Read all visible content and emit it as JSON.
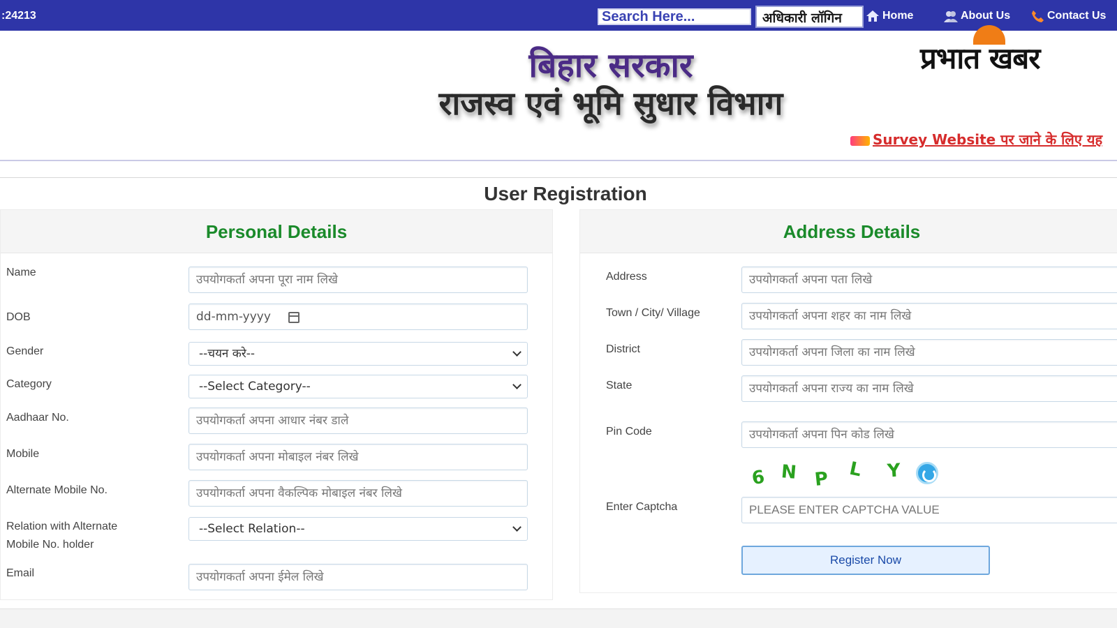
{
  "topbar": {
    "counter": ":24213",
    "search_placeholder": "Search Here...",
    "login_label": "अधिकारी लॉगिन",
    "nav": [
      {
        "label": "Home",
        "icon": "home-icon"
      },
      {
        "label": "About Us",
        "icon": "users-icon"
      },
      {
        "label": "Contact Us",
        "icon": "phone-icon"
      }
    ],
    "bg_color": "#2e35a8"
  },
  "header": {
    "line1": "बिहार सरकार",
    "line2": "राजस्व एवं भूमि सुधार विभाग",
    "logo_text": "प्रभात खबर",
    "survey_link": "Survey Website पर जाने के लिए यह"
  },
  "form": {
    "title": "User Registration",
    "personal": {
      "heading": "Personal Details",
      "name_label": "Name",
      "name_placeholder": "उपयोगकर्ता अपना पूरा नाम लिखे",
      "dob_label": "DOB",
      "dob_placeholder": "dd-mm-yyyy",
      "gender_label": "Gender",
      "gender_value": "--चयन करे--",
      "category_label": "Category",
      "category_value": "--Select Category--",
      "aadhaar_label": "Aadhaar No.",
      "aadhaar_placeholder": "उपयोगकर्ता अपना आधार नंबर डाले",
      "mobile_label": "Mobile",
      "mobile_placeholder": "उपयोगकर्ता अपना मोबाइल नंबर लिखे",
      "alt_mobile_label": "Alternate Mobile No.",
      "alt_mobile_placeholder": "उपयोगकर्ता अपना वैकल्पिक मोबाइल नंबर लिखे",
      "relation_label_1": "Relation with Alternate",
      "relation_label_2": "Mobile No. holder",
      "relation_value": "--Select Relation--",
      "email_label": "Email",
      "email_placeholder": "उपयोगकर्ता अपना ईमेल लिखे"
    },
    "address": {
      "heading": "Address Details",
      "address_label": "Address",
      "address_placeholder": "उपयोगकर्ता अपना पता लिखे",
      "town_label": "Town / City/ Village",
      "town_placeholder": "उपयोगकर्ता अपना शहर का नाम लिखे",
      "district_label": "District",
      "district_placeholder": "उपयोगकर्ता अपना जिला का नाम लिखे",
      "state_label": "State",
      "state_placeholder": "उपयोगकर्ता अपना राज्य का नाम लिखे",
      "pin_label": "Pin Code",
      "pin_placeholder": "उपयोगकर्ता अपना पिन कोड लिखे",
      "captcha_chars": [
        "6",
        "N",
        "P",
        "L",
        "Y"
      ],
      "captcha_label": "Enter Captcha",
      "captcha_placeholder": "PLEASE ENTER CAPTCHA VALUE",
      "register_label": "Register Now"
    }
  }
}
